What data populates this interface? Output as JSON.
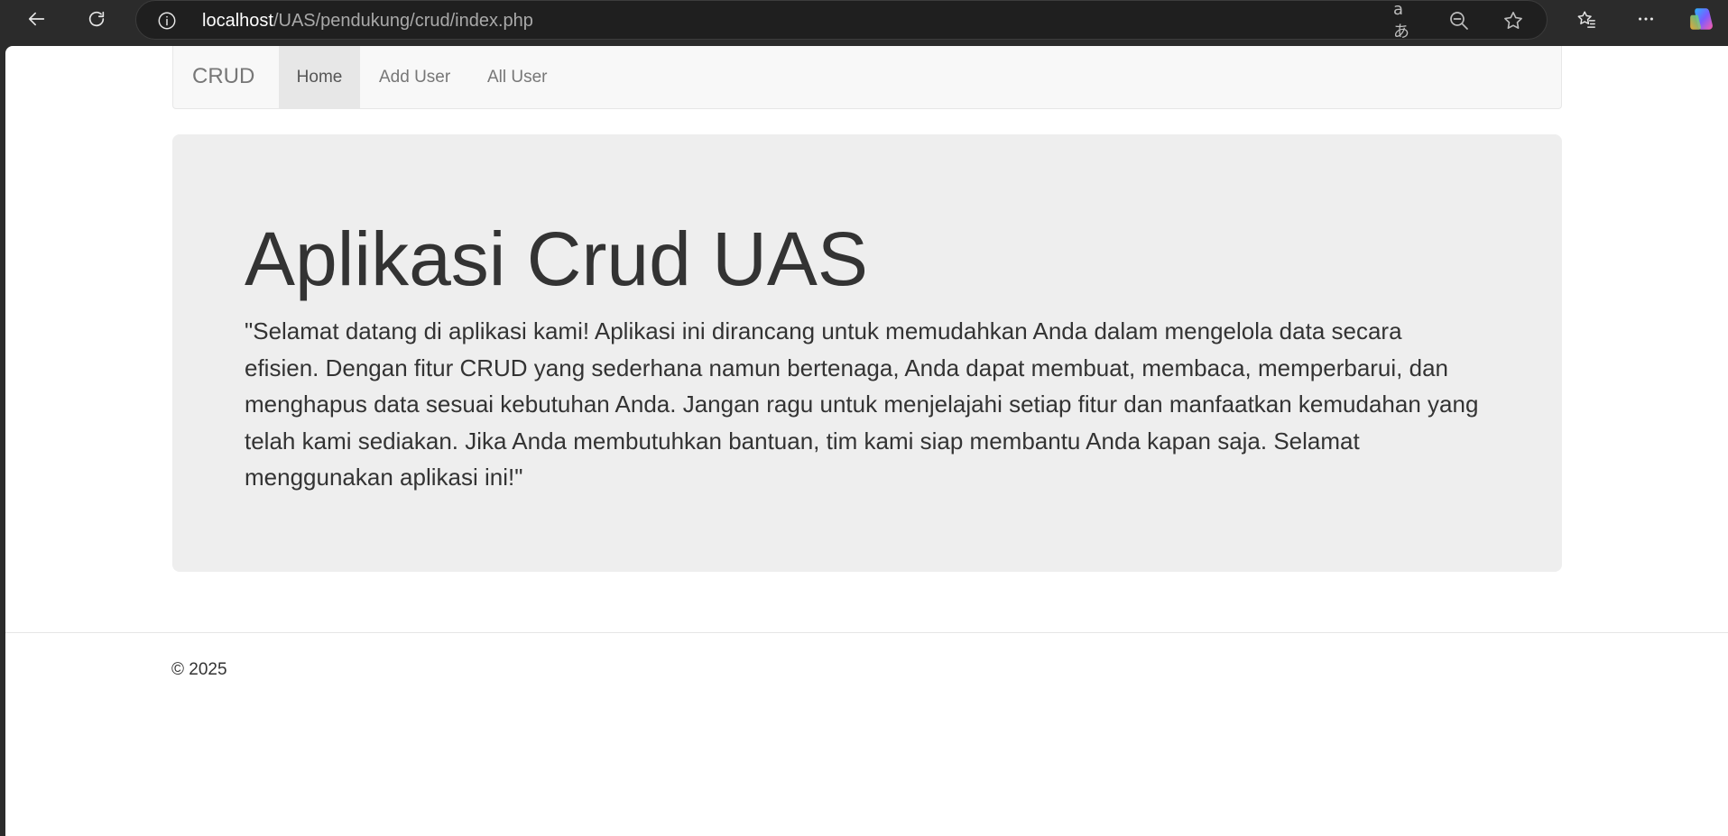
{
  "browser": {
    "url_host": "localhost",
    "url_path": "/UAS/pendukung/crud/index.php",
    "icons": [
      "back-arrow-icon",
      "reload-icon",
      "info-icon",
      "translate-icon",
      "zoom-out-icon",
      "star-icon",
      "favorites-icon",
      "more-icon",
      "copilot-icon"
    ],
    "translate_glyph": "aあ"
  },
  "navbar": {
    "brand": "CRUD",
    "items": [
      {
        "label": "Home",
        "active": true
      },
      {
        "label": "Add User",
        "active": false
      },
      {
        "label": "All User",
        "active": false
      }
    ]
  },
  "jumbotron": {
    "title": "Aplikasi Crud UAS",
    "text": "\"Selamat datang di aplikasi kami! Aplikasi ini dirancang untuk memudahkan Anda dalam mengelola data secara efisien. Dengan fitur CRUD yang sederhana namun bertenaga, Anda dapat membuat, membaca, memperbarui, dan menghapus data sesuai kebutuhan Anda. Jangan ragu untuk menjelajahi setiap fitur dan manfaatkan kemudahan yang telah kami sediakan. Jika Anda membutuhkan bantuan, tim kami siap membantu Anda kapan saja. Selamat menggunakan aplikasi ini!\""
  },
  "footer": {
    "text": "© 2025"
  },
  "colors": {
    "chrome_bg": "#2b2b2b",
    "navbar_bg": "#f8f8f8",
    "jumbotron_bg": "#eeeeee",
    "text": "#333333",
    "nav_text": "#777777"
  }
}
